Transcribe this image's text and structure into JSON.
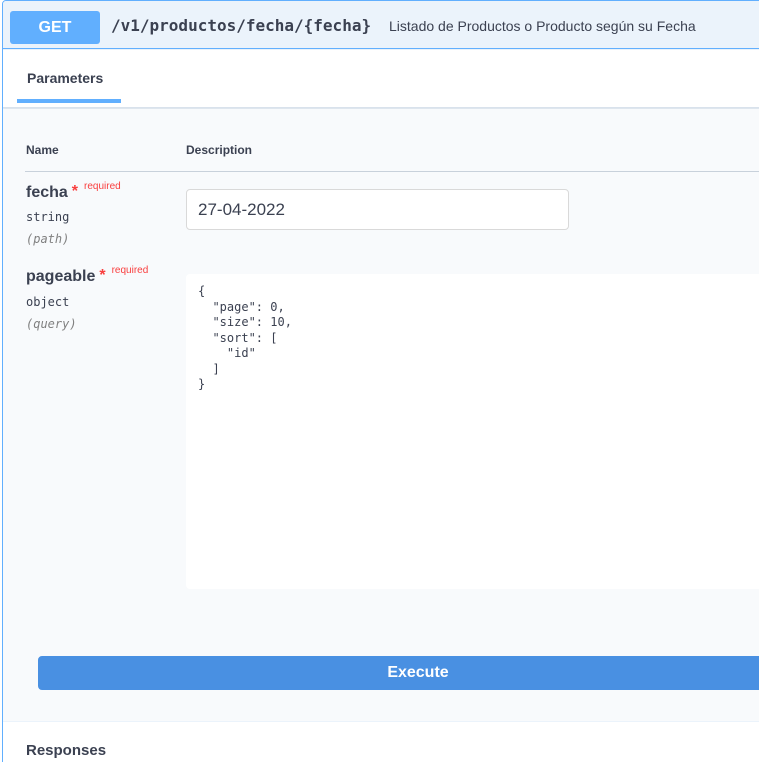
{
  "operation": {
    "method": "GET",
    "path": "/v1/productos/fecha/{fecha}",
    "summary": "Listado de Productos o Producto según su Fecha"
  },
  "tabs": {
    "parameters_label": "Parameters"
  },
  "table": {
    "name_header": "Name",
    "description_header": "Description"
  },
  "params": [
    {
      "name": "fecha",
      "required_star": "*",
      "required_label": "required",
      "type": "string",
      "in": "(path)",
      "value": "27-04-2022"
    },
    {
      "name": "pageable",
      "required_star": "*",
      "required_label": "required",
      "type": "object",
      "in": "(query)",
      "value": "{\n  \"page\": 0,\n  \"size\": 10,\n  \"sort\": [\n    \"id\"\n  ]\n}"
    }
  ],
  "actions": {
    "execute_label": "Execute"
  },
  "responses": {
    "label": "Responses"
  },
  "colors": {
    "get_accent": "#61affe",
    "execute": "#4990e2",
    "required": "#f93e3e"
  }
}
